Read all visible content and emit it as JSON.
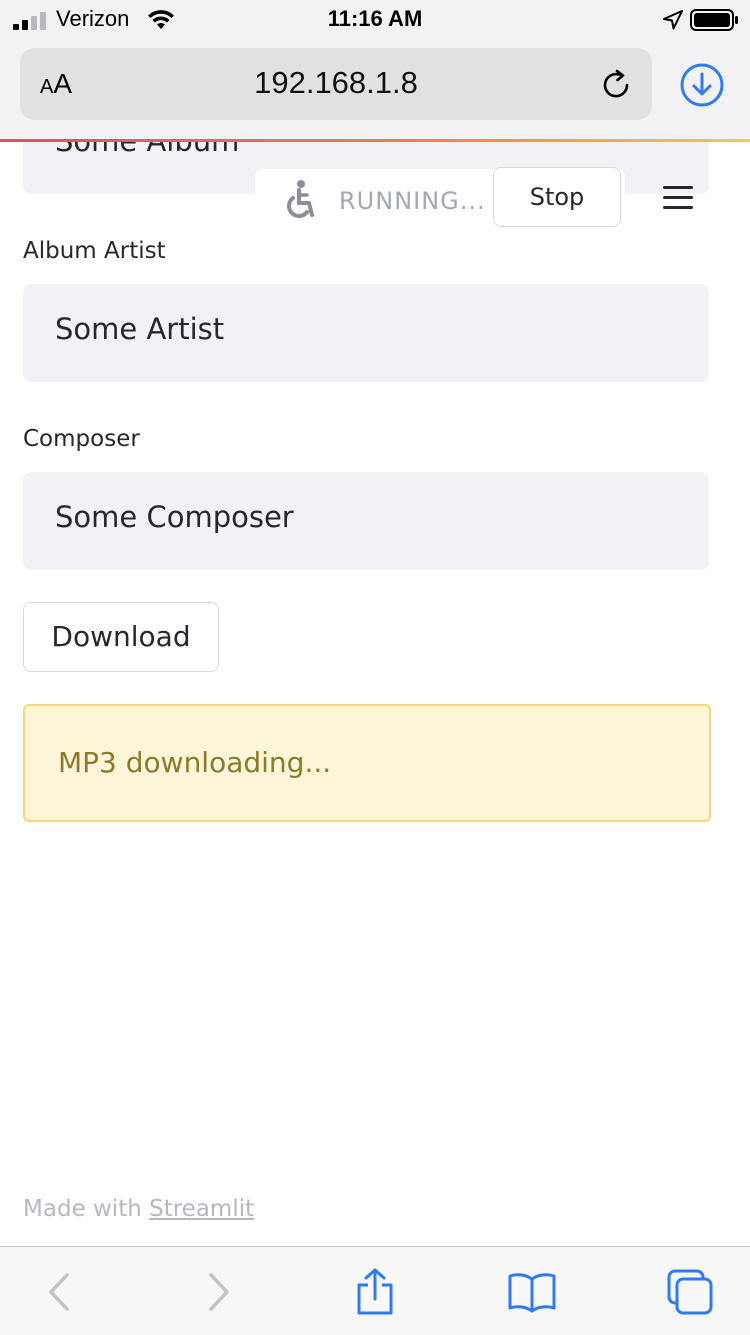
{
  "status_bar": {
    "carrier": "Verizon",
    "time": "11:16 AM",
    "signal_icon": "signal-bars-icon",
    "wifi_icon": "wifi-icon",
    "location_icon": "location-arrow-icon",
    "battery_icon": "battery-icon"
  },
  "browser": {
    "text_size_label_small": "A",
    "text_size_label_large": "A",
    "url": "192.168.1.8",
    "reload_icon": "reload-icon",
    "downloads_icon": "download-circle-icon",
    "accent_color": "#2f7bf0"
  },
  "app": {
    "album_field": {
      "value": "Some Album"
    },
    "album_artist_field": {
      "label": "Album Artist",
      "value": "Some Artist"
    },
    "composer_field": {
      "label": "Composer",
      "value": "Some Composer"
    },
    "status_widget": {
      "text": "RUNNING...",
      "stop_label": "Stop"
    },
    "menu_icon": "hamburger-menu-icon",
    "download_button_label": "Download",
    "alert": {
      "text": "MP3 downloading...",
      "background": "#fcf5d8",
      "border": "#f3d77a",
      "text_color": "#8c7a2c"
    },
    "footer": {
      "prefix": "Made with ",
      "link": "Streamlit"
    }
  },
  "toolbar": {
    "items": [
      "back-icon",
      "forward-icon",
      "share-icon",
      "bookmarks-icon",
      "tabs-icon"
    ]
  }
}
